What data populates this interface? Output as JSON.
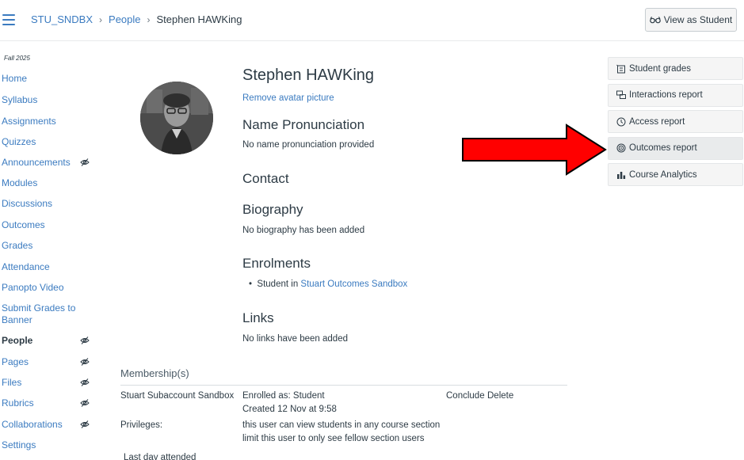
{
  "header": {
    "breadcrumb": [
      "STU_SNDBX",
      "People",
      "Stephen HAWKing"
    ],
    "view_as_student": "View as Student"
  },
  "nav": {
    "term": "Fall 2025",
    "items": [
      {
        "label": "Home",
        "hidden": false
      },
      {
        "label": "Syllabus",
        "hidden": false
      },
      {
        "label": "Assignments",
        "hidden": false
      },
      {
        "label": "Quizzes",
        "hidden": false
      },
      {
        "label": "Announcements",
        "hidden": true
      },
      {
        "label": "Modules",
        "hidden": false
      },
      {
        "label": "Discussions",
        "hidden": false
      },
      {
        "label": "Outcomes",
        "hidden": false
      },
      {
        "label": "Grades",
        "hidden": false
      },
      {
        "label": "Attendance",
        "hidden": false
      },
      {
        "label": "Panopto Video",
        "hidden": false
      },
      {
        "label": "Submit Grades to Banner",
        "hidden": false
      },
      {
        "label": "People",
        "hidden": true,
        "active": true
      },
      {
        "label": "Pages",
        "hidden": true
      },
      {
        "label": "Files",
        "hidden": true
      },
      {
        "label": "Rubrics",
        "hidden": true
      },
      {
        "label": "Collaborations",
        "hidden": true
      },
      {
        "label": "Settings",
        "hidden": false
      }
    ]
  },
  "profile": {
    "name": "Stephen HAWKing",
    "remove_avatar": "Remove avatar picture",
    "pronunciation_heading": "Name Pronunciation",
    "pronunciation_text": "No name pronunciation provided",
    "contact_heading": "Contact",
    "biography_heading": "Biography",
    "biography_text": "No biography has been added",
    "enrolments_heading": "Enrolments",
    "enrolment_prefix": "Student in",
    "enrolment_course": "Stuart Outcomes Sandbox",
    "links_heading": "Links",
    "links_text": "No links have been added"
  },
  "membership": {
    "title": "Membership(s)",
    "section": "Stuart Subaccount Sandbox",
    "enrolled_as": "Enrolled as: Student",
    "created": "Created 12 Nov at 9:58",
    "conclude": "Conclude",
    "delete": "Delete",
    "privileges_label": "Privileges:",
    "privileges_text": "this user can view students in any course section",
    "limit_link": "limit this user to only see fellow section users",
    "last_day": "Last day attended"
  },
  "sidebar": {
    "buttons": [
      {
        "label": "Student grades",
        "icon": "gradebook-icon"
      },
      {
        "label": "Interactions report",
        "icon": "interactions-icon"
      },
      {
        "label": "Access report",
        "icon": "clock-icon"
      },
      {
        "label": "Outcomes report",
        "icon": "target-icon"
      },
      {
        "label": "Course Analytics",
        "icon": "bar-chart-icon"
      }
    ]
  },
  "colors": {
    "link": "#3b7bc0",
    "text": "#2d3b45",
    "arrow": "#ff0000"
  }
}
